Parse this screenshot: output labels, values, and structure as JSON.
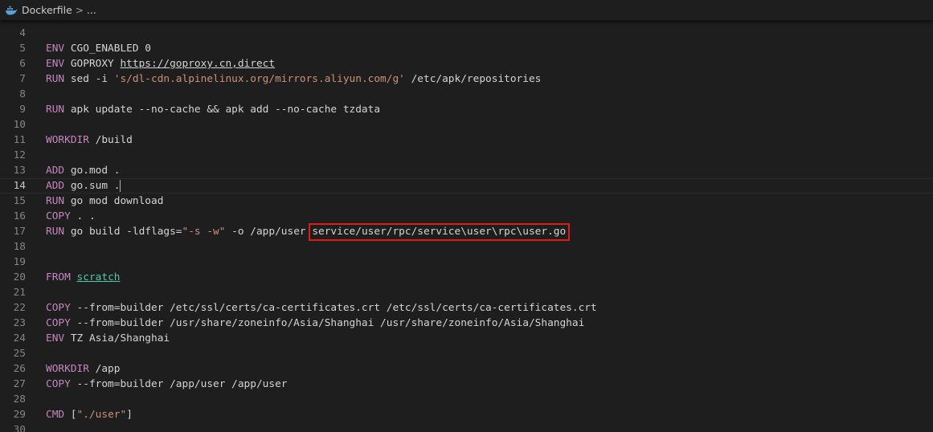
{
  "breadcrumb": {
    "file": "Dockerfile",
    "separator": ">",
    "trail": "..."
  },
  "editor": {
    "current_line": 14,
    "highlighted_text": "service/user/rpc/service\\user\\rpc\\user.go",
    "highlight_color": "#e01b1b",
    "colors": {
      "background": "#1e1e1e",
      "keyword": "#c586c0",
      "string": "#ce9178",
      "text": "#d4d4d4",
      "line_number": "#858585",
      "stage_name": "#4ec9b0"
    },
    "lines": [
      {
        "n": "4",
        "parts": []
      },
      {
        "n": "5",
        "parts": [
          {
            "t": "ENV",
            "c": "kw"
          },
          {
            "t": " CGO_ENABLED 0"
          }
        ]
      },
      {
        "n": "6",
        "parts": [
          {
            "t": "ENV",
            "c": "kw"
          },
          {
            "t": " GOPROXY "
          },
          {
            "t": "https://goproxy.cn,direct",
            "c": "link"
          }
        ]
      },
      {
        "n": "7",
        "parts": [
          {
            "t": "RUN",
            "c": "kw"
          },
          {
            "t": " sed -i "
          },
          {
            "t": "'s/dl-cdn.alpinelinux.org/mirrors.aliyun.com/g'",
            "c": "str"
          },
          {
            "t": " /etc/apk/repositories"
          }
        ]
      },
      {
        "n": "8",
        "parts": []
      },
      {
        "n": "9",
        "parts": [
          {
            "t": "RUN",
            "c": "kw"
          },
          {
            "t": " apk update --no-cache && apk add --no-cache tzdata"
          }
        ]
      },
      {
        "n": "10",
        "parts": []
      },
      {
        "n": "11",
        "parts": [
          {
            "t": "WORKDIR",
            "c": "kw"
          },
          {
            "t": " /build"
          }
        ]
      },
      {
        "n": "12",
        "parts": []
      },
      {
        "n": "13",
        "parts": [
          {
            "t": "ADD",
            "c": "kw"
          },
          {
            "t": " go.mod ."
          }
        ]
      },
      {
        "n": "14",
        "parts": [
          {
            "t": "ADD",
            "c": "kw"
          },
          {
            "t": " go.sum ."
          },
          {
            "t": "",
            "c": "cursor"
          }
        ]
      },
      {
        "n": "15",
        "parts": [
          {
            "t": "RUN",
            "c": "kw"
          },
          {
            "t": " go mod download"
          }
        ]
      },
      {
        "n": "16",
        "parts": [
          {
            "t": "COPY",
            "c": "kw"
          },
          {
            "t": " . ."
          }
        ]
      },
      {
        "n": "17",
        "parts": [
          {
            "t": "RUN",
            "c": "kw"
          },
          {
            "t": " go build -ldflags="
          },
          {
            "t": "\"-s -w\"",
            "c": "str"
          },
          {
            "t": " -o /app/user service/user/rpc/service\\user\\rpc\\user.go"
          }
        ]
      },
      {
        "n": "18",
        "parts": []
      },
      {
        "n": "19",
        "parts": []
      },
      {
        "n": "20",
        "parts": [
          {
            "t": "FROM",
            "c": "kw"
          },
          {
            "t": " "
          },
          {
            "t": "scratch",
            "c": "stage"
          }
        ]
      },
      {
        "n": "21",
        "parts": []
      },
      {
        "n": "22",
        "parts": [
          {
            "t": "COPY",
            "c": "kw"
          },
          {
            "t": " --from=builder /etc/ssl/certs/ca-certificates.crt /etc/ssl/certs/ca-certificates.crt"
          }
        ]
      },
      {
        "n": "23",
        "parts": [
          {
            "t": "COPY",
            "c": "kw"
          },
          {
            "t": " --from=builder /usr/share/zoneinfo/Asia/Shanghai /usr/share/zoneinfo/Asia/Shanghai"
          }
        ]
      },
      {
        "n": "24",
        "parts": [
          {
            "t": "ENV",
            "c": "kw"
          },
          {
            "t": " TZ Asia/Shanghai"
          }
        ]
      },
      {
        "n": "25",
        "parts": []
      },
      {
        "n": "26",
        "parts": [
          {
            "t": "WORKDIR",
            "c": "kw"
          },
          {
            "t": " /app"
          }
        ]
      },
      {
        "n": "27",
        "parts": [
          {
            "t": "COPY",
            "c": "kw"
          },
          {
            "t": " --from=builder /app/user /app/user"
          }
        ]
      },
      {
        "n": "28",
        "parts": []
      },
      {
        "n": "29",
        "parts": [
          {
            "t": "CMD",
            "c": "kw"
          },
          {
            "t": " ["
          },
          {
            "t": "\"./user\"",
            "c": "str"
          },
          {
            "t": "]"
          }
        ]
      },
      {
        "n": "30",
        "parts": []
      }
    ]
  }
}
